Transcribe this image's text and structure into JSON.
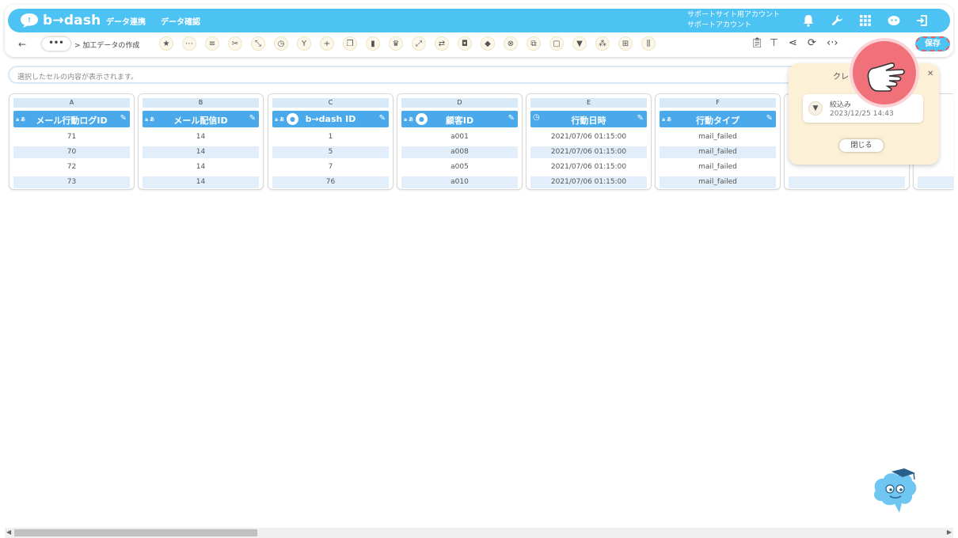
{
  "header": {
    "brand": "b→dash",
    "nav": [
      "データ連携",
      "データ確認"
    ],
    "account_line1": "サポートサイト用アカウント",
    "account_line2": "サポートアカウント"
  },
  "toolbar": {
    "back": "←",
    "more": "•••",
    "breadcrumb": "> 加工データの作成",
    "save_label": "保存"
  },
  "cell_bar": {
    "placeholder": "選択したセルの内容が表示されます。"
  },
  "columns": [
    {
      "letter": "A",
      "type": "a あ",
      "name": "メール行動ログID",
      "rows": [
        "71",
        "70",
        "72",
        "73"
      ]
    },
    {
      "letter": "B",
      "type": "a あ",
      "name": "メール配信ID",
      "rows": [
        "14",
        "14",
        "14",
        "14"
      ]
    },
    {
      "letter": "C",
      "type": "a あ",
      "name": "b→dash ID",
      "rows": [
        "1",
        "5",
        "7",
        "76"
      ]
    },
    {
      "letter": "D",
      "type": "a あ",
      "name": "顧客ID",
      "rows": [
        "a001",
        "a008",
        "a005",
        "a010"
      ]
    },
    {
      "letter": "E",
      "type": "",
      "name": "行動日時",
      "rows": [
        "2021/07/06 01:15:00",
        "2021/07/06 01:15:00",
        "2021/07/06 01:15:00",
        "2021/07/06 01:15:00"
      ]
    },
    {
      "letter": "F",
      "type": "a あ",
      "name": "行動タイプ",
      "rows": [
        "mail_failed",
        "mail_failed",
        "mail_failed",
        "mail_failed"
      ]
    }
  ],
  "popup": {
    "title": "クレ",
    "item_name": "絞込み",
    "item_date": "2023/12/25 14:43",
    "close_label": "閉じる"
  },
  "colors": {
    "header": "#4dc3f3",
    "column_header": "#4aa9ea",
    "popup_bg": "#fcf1d6",
    "pointer": "#f0717a"
  }
}
